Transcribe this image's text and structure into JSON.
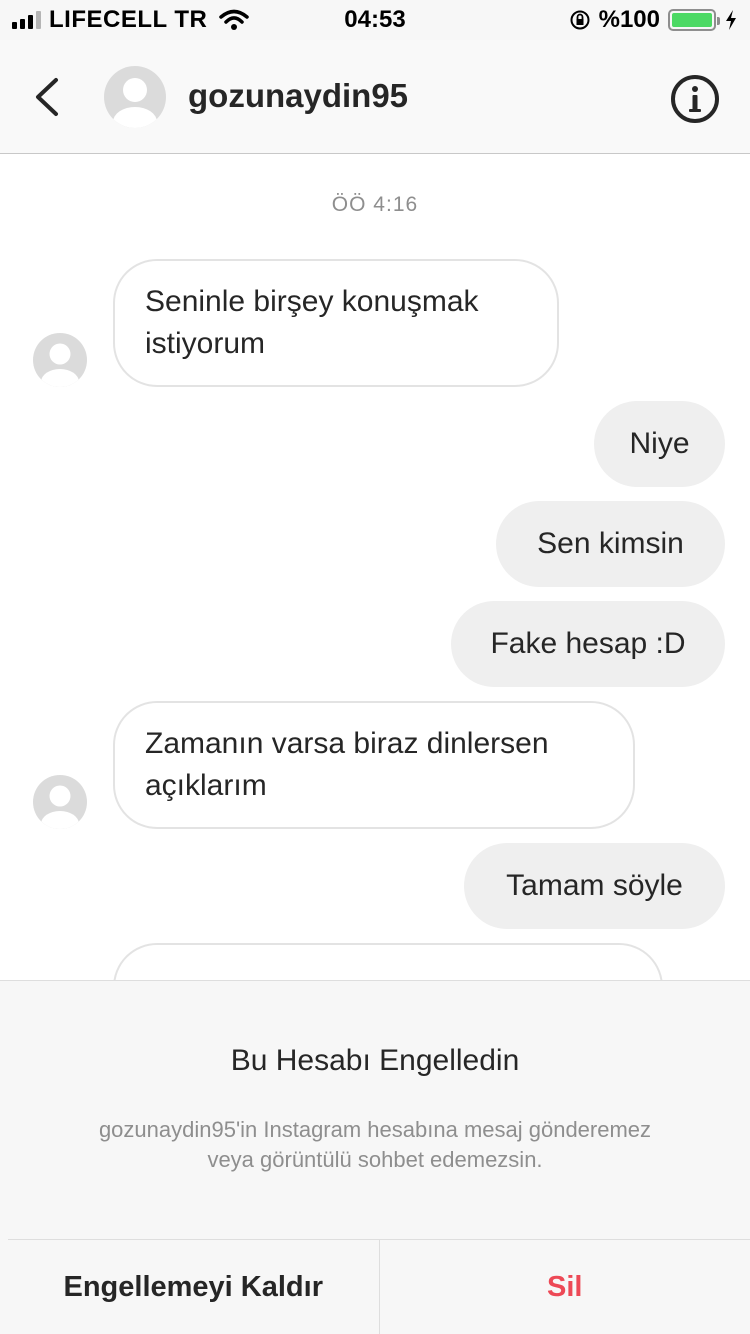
{
  "status_bar": {
    "carrier": "LIFECELL TR",
    "time": "04:53",
    "battery": "%100",
    "battery_level": 1.0,
    "icons": [
      "signal-icon",
      "wifi-icon",
      "rotation-lock-icon",
      "battery-icon",
      "charging-icon"
    ]
  },
  "header": {
    "username": "gozunaydin95",
    "icons": [
      "back-chevron-icon",
      "avatar-placeholder-icon",
      "info-icon"
    ]
  },
  "thread": {
    "timestamp": "ÖÖ 4:16",
    "messages": [
      {
        "from": "them",
        "text": "Seninle birşey konuşmak istiyorum"
      },
      {
        "from": "me",
        "text": "Niye"
      },
      {
        "from": "me",
        "text": "Sen kimsin"
      },
      {
        "from": "me",
        "text": "Fake hesap :D"
      },
      {
        "from": "them",
        "text": "Zamanın varsa biraz dinlersen açıklarım"
      },
      {
        "from": "me",
        "text": "Tamam söyle"
      }
    ]
  },
  "blocked": {
    "title": "Bu Hesabı Engelledin",
    "description": "gozunaydin95'in Instagram hesabına mesaj gönderemez veya görüntülü sohbet edemezsin.",
    "unblock_label": "Engellemeyi Kaldır",
    "delete_label": "Sil"
  },
  "colors": {
    "accent_delete": "#ed4956",
    "battery": "#4cd964",
    "outgoing_bubble": "#efefef",
    "secondary_text": "#8e8e8e"
  }
}
